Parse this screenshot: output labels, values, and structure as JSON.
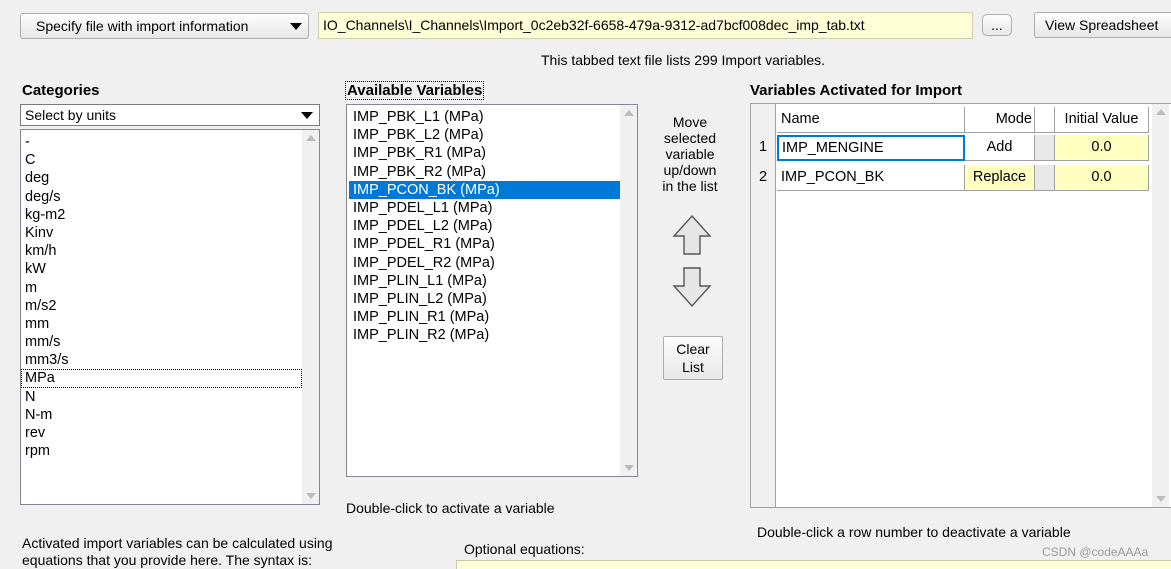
{
  "toolbar": {
    "import_mode_select": "Specify file with import information",
    "file_path": "IO_Channels\\I_Channels\\Import_0c2eb32f-6658-479a-9312-ad7bcf008dec_imp_tab.txt",
    "browse_label": "...",
    "view_spreadsheet_label": "View Spreadsheet"
  },
  "info_text": "This tabbed text file lists 299 Import variables.",
  "categories": {
    "header": "Categories",
    "filter_select": "Select by units",
    "items": [
      "-",
      "C",
      "deg",
      "deg/s",
      "kg-m2",
      "Kinv",
      "km/h",
      "kW",
      "m",
      "m/s2",
      "mm",
      "mm/s",
      "mm3/s",
      "MPa",
      "N",
      "N-m",
      "rev",
      "rpm"
    ],
    "selected": "MPa"
  },
  "available": {
    "header": "Available Variables",
    "items": [
      "IMP_PBK_L1 (MPa)",
      "IMP_PBK_L2 (MPa)",
      "IMP_PBK_R1 (MPa)",
      "IMP_PBK_R2 (MPa)",
      "IMP_PCON_BK (MPa)",
      "IMP_PDEL_L1 (MPa)",
      "IMP_PDEL_L2 (MPa)",
      "IMP_PDEL_R1 (MPa)",
      "IMP_PDEL_R2 (MPa)",
      "IMP_PLIN_L1 (MPa)",
      "IMP_PLIN_L2 (MPa)",
      "IMP_PLIN_R1 (MPa)",
      "IMP_PLIN_R2 (MPa)"
    ],
    "selected": "IMP_PCON_BK (MPa)",
    "hint": "Double-click to activate a variable"
  },
  "move": {
    "text_lines": [
      "Move",
      "selected",
      "variable",
      "up/down",
      "in the list"
    ],
    "clear_lines": [
      "Clear",
      "List"
    ]
  },
  "activated": {
    "header": "Variables Activated for Import",
    "columns": [
      "Name",
      "Mode",
      "Initial Value"
    ],
    "rows": [
      {
        "num": "1",
        "name": "IMP_MENGINE",
        "mode": "Add",
        "value": "0.0"
      },
      {
        "num": "2",
        "name": "IMP_PCON_BK",
        "mode": "Replace",
        "value": "0.0"
      }
    ],
    "hint": "Double-click a row number to deactivate a variable"
  },
  "bottom": {
    "desc_line1": "Activated import variables can be calculated using",
    "desc_line2": "equations that you provide here. The syntax is:",
    "optional_label": "Optional equations:"
  },
  "watermark": "CSDN @codeAAAa",
  "colors": {
    "selection": "#0078d7",
    "value_cell": "#ffffc0",
    "path_bg": "#ffffd7"
  }
}
